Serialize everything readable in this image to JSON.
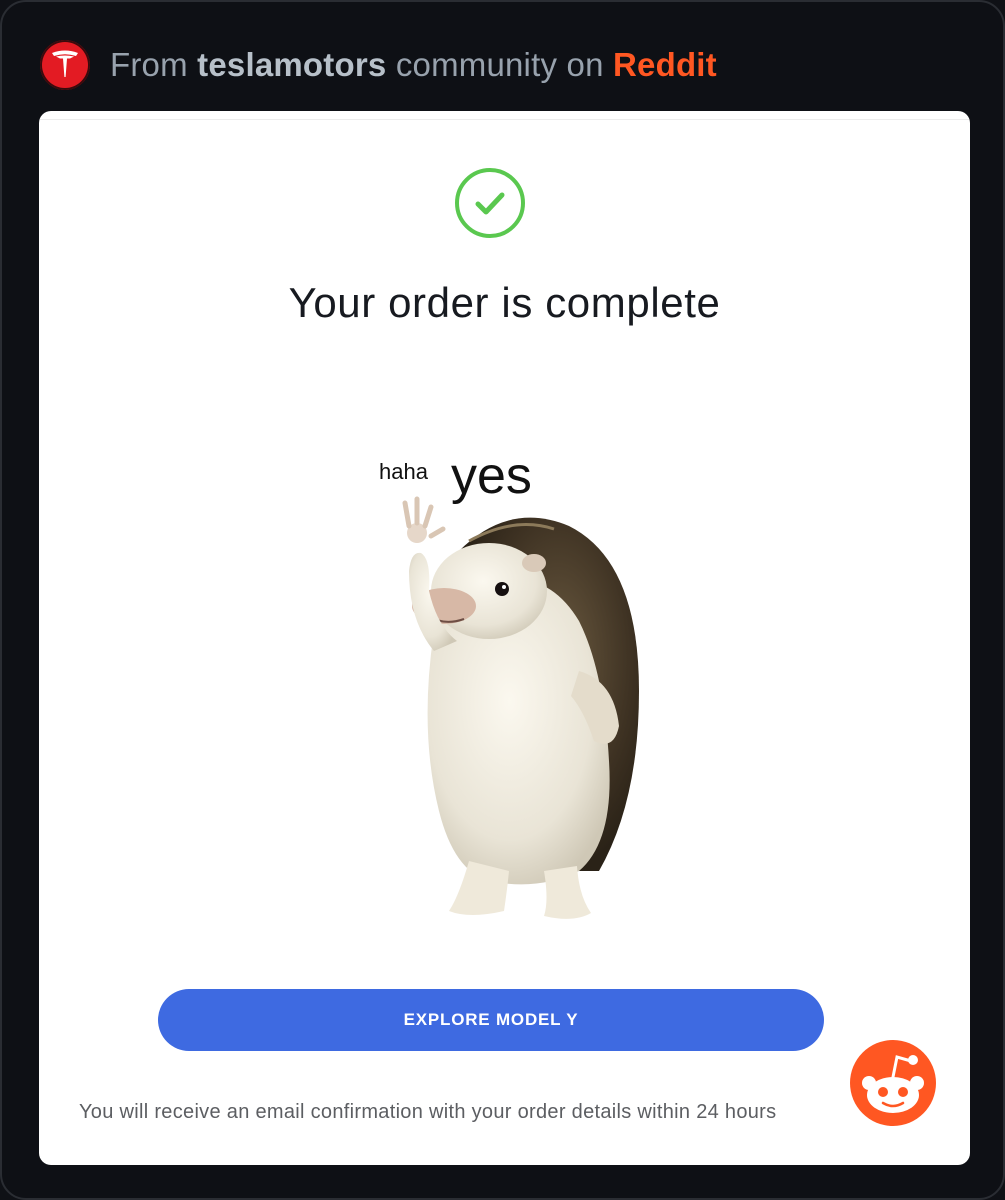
{
  "header": {
    "prefix": "From",
    "community": "teslamotors",
    "middle": "community on",
    "platform": "Reddit"
  },
  "order": {
    "title": "Your order is complete",
    "button_label": "EXPLORE MODEL Y",
    "footnote": "You will receive an email confirmation with your order details within 24 hours"
  },
  "meme": {
    "small_text": "haha",
    "big_text": "yes"
  },
  "icons": {
    "badge": "tesla-logo-icon",
    "success": "checkmark-circle-icon",
    "mascot": "reddit-snoo-icon"
  },
  "colors": {
    "tesla_red": "#e31b23",
    "reddit_orange": "#ff5722",
    "success_green": "#5ac84f",
    "button_blue": "#3e6ae1"
  }
}
